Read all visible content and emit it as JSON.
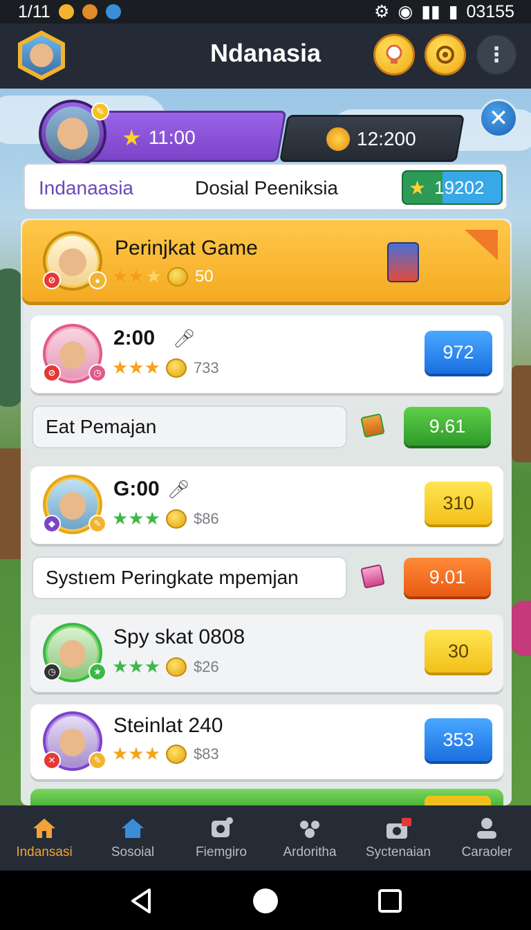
{
  "status_bar": {
    "time": "1/11",
    "clock": "03155"
  },
  "app_bar": {
    "title": "Ndanasia",
    "menu_glyph": "⋮"
  },
  "hud": {
    "star_value": "11:00",
    "gear_value": "12:200",
    "close_glyph": "✕"
  },
  "tabs": {
    "left": "Indanaasia",
    "center": "Dosial Peeniksia",
    "score": "19202"
  },
  "rows": [
    {
      "name": "Perinjkat Game",
      "sub": "50",
      "value": null
    },
    {
      "name": "2:00",
      "sub": "733",
      "value": "972"
    },
    {
      "name": "G:00",
      "sub": "$86",
      "value": "310"
    },
    {
      "name": "Spy skat 0808",
      "sub": "$26",
      "value": "30"
    },
    {
      "name": "Steinlat 240",
      "sub": "$83",
      "value": "353"
    }
  ],
  "bars": [
    {
      "label": "Eat Pemajan",
      "value": "9.61"
    },
    {
      "label": "Systıem Peringkate mpemjan",
      "value": "9.01"
    }
  ],
  "bottom_nav": [
    {
      "label": "Indansasi",
      "icon": "home-icon"
    },
    {
      "label": "Sosoial",
      "icon": "home-icon"
    },
    {
      "label": "Fiemgiro",
      "icon": "gear-icon"
    },
    {
      "label": "Ardoritha",
      "icon": "people-icon"
    },
    {
      "label": "Syctenaian",
      "icon": "camera-icon"
    },
    {
      "label": "Caraoler",
      "icon": "person-icon"
    }
  ],
  "colors": {
    "accent": "#f2a23a",
    "purple": "#7b44c8",
    "blue": "#1a6fe0"
  }
}
